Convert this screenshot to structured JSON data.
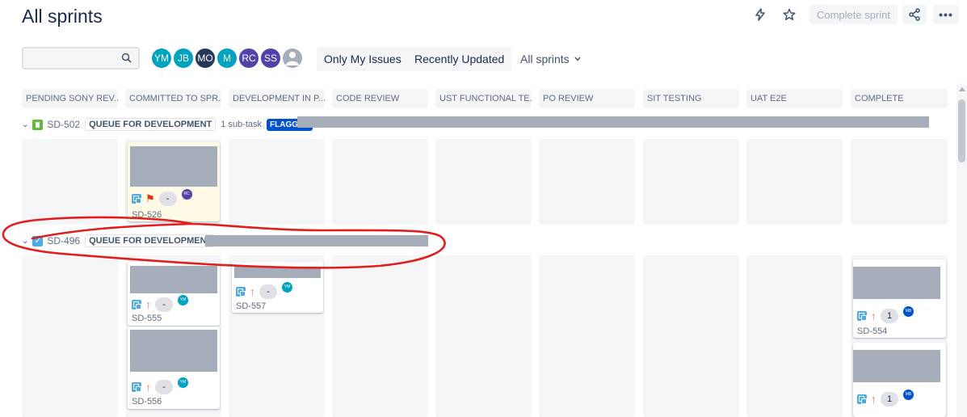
{
  "header": {
    "title": "All sprints",
    "complete_sprint_label": "Complete sprint",
    "icons": [
      "lightning-icon",
      "star-icon",
      "share-icon",
      "more-icon"
    ]
  },
  "filters": {
    "search_value": "",
    "avatars": [
      {
        "initials": "YM",
        "color": "#00a3bf"
      },
      {
        "initials": "JB",
        "color": "#00a3bf"
      },
      {
        "initials": "MO",
        "color": "#253858"
      },
      {
        "initials": "M",
        "color": "#00a3bf"
      },
      {
        "initials": "RC",
        "color": "#5243aa"
      },
      {
        "initials": "SS",
        "color": "#5243aa"
      }
    ],
    "only_my_issues": "Only My Issues",
    "recently_updated": "Recently Updated",
    "sprints_dropdown": "All sprints"
  },
  "columns": [
    "PENDING SONY REV...",
    "COMMITTED TO SPR...",
    "DEVELOPMENT IN P...",
    "CODE REVIEW",
    "UST FUNCTIONAL TE...",
    "PO REVIEW",
    "SIT TESTING",
    "UAT E2E",
    "COMPLETE"
  ],
  "swimlanes": [
    {
      "key": "SD-502",
      "status": "QUEUE FOR DEVELOPMENT",
      "subtasks": "1 sub-task",
      "flag": "FLAGGED"
    },
    {
      "key": "SD-496",
      "status": "QUEUE FOR DEVELOPMENT"
    }
  ],
  "cards": [
    {
      "key": "SD-526",
      "estimate": "-",
      "assignee": "RC",
      "assignee_color": "#5243aa",
      "flagged": true
    },
    {
      "key": "SD-555",
      "estimate": "-",
      "assignee": "YM",
      "assignee_color": "#00a3bf"
    },
    {
      "key": "SD-556",
      "estimate": "-",
      "assignee": "YM",
      "assignee_color": "#00a3bf"
    },
    {
      "key": "SD-557",
      "estimate": "-",
      "assignee": "YM",
      "assignee_color": "#00a3bf"
    },
    {
      "key": "SD-554",
      "estimate": "1",
      "assignee": "MB",
      "assignee_color": "#0052cc"
    },
    {
      "key": "",
      "estimate": "1",
      "assignee": "MB",
      "assignee_color": "#0052cc"
    }
  ],
  "colors": {
    "accent": "#0052cc",
    "annotation": "#e11d1d"
  }
}
